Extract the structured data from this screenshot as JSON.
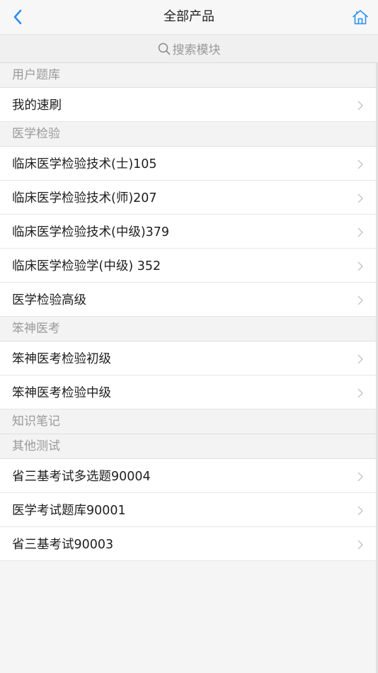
{
  "nav": {
    "title": "全部产品",
    "accent_color": "#2a8ff0",
    "back_icon": "chevron-left-icon",
    "home_icon": "home-icon"
  },
  "search": {
    "placeholder": "搜索模块",
    "icon": "search-icon"
  },
  "sections": [
    {
      "header": "用户题库",
      "items": [
        {
          "label": "我的速刷"
        }
      ]
    },
    {
      "header": "医学检验",
      "items": [
        {
          "label": "临床医学检验技术(士)105"
        },
        {
          "label": "临床医学检验技术(师)207"
        },
        {
          "label": "临床医学检验技术(中级)379"
        },
        {
          "label": "临床医学检验学(中级) 352"
        },
        {
          "label": "医学检验高级"
        }
      ]
    },
    {
      "header": "笨神医考",
      "items": [
        {
          "label": "笨神医考检验初级"
        },
        {
          "label": "笨神医考检验中级"
        }
      ]
    },
    {
      "header": "知识笔记",
      "items": []
    },
    {
      "header": "其他测试",
      "items": [
        {
          "label": "省三基考试多选题90004"
        },
        {
          "label": "医学考试题库90001"
        },
        {
          "label": "省三基考试90003"
        }
      ]
    }
  ]
}
